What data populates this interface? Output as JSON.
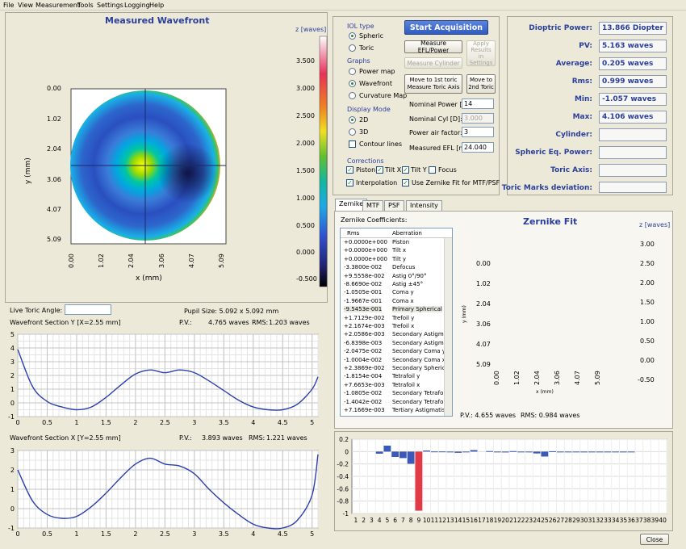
{
  "menu": [
    "File",
    "View",
    "Measurement",
    "Tools",
    "Settings",
    "Logging",
    "Help"
  ],
  "wavefront_map": {
    "title": "Measured Wavefront",
    "xlabel": "x (mm)",
    "ylabel": "y (mm)",
    "ticks": [
      "0.00",
      "1.02",
      "2.04",
      "3.06",
      "4.07",
      "5.09"
    ],
    "colorbar_title": "z [waves]",
    "colorbar_ticks": [
      "3.500",
      "3.000",
      "2.500",
      "2.000",
      "1.500",
      "1.000",
      "0.500",
      "0.000",
      "-0.500"
    ]
  },
  "controls": {
    "iol_type_label": "IOL type",
    "iol_spheric": "Spheric",
    "iol_toric": "Toric",
    "graphs_label": "Graphs",
    "graph_power": "Power map",
    "graph_wavefront": "Wavefront",
    "graph_curvature": "Curvature Map",
    "display_label": "Display Mode",
    "display_2d": "2D",
    "display_3d": "3D",
    "contour": "Contour lines",
    "start": "Start Acquisition",
    "measure_efl": "Measure EFL/Power",
    "apply_results": "Apply Results in Settings",
    "measure_cylinder": "Measure Cylinder",
    "move_first": "Move to 1st toric Measure Toric Axis",
    "move_second": "Move to 2nd Toric",
    "nominal_power_label": "Nominal Power [D]:",
    "nominal_power": "14",
    "nominal_cyl_label": "Nominal Cyl [D]:",
    "nominal_cyl": "3.000",
    "power_air_label": "Power air factor:",
    "power_air": "3",
    "measured_efl_label": "Measured EFL [mm]:",
    "measured_efl": "24.040",
    "corrections_label": "Corrections",
    "piston": "Piston",
    "tilt_x": "Tilt X",
    "tilt_y": "Tilt Y",
    "focus": "Focus",
    "interpolation": "Interpolation",
    "use_zernike": "Use Zernike Fit for MTF/PSF"
  },
  "results": [
    {
      "label": "Dioptric Power:",
      "value": "13.866 Diopter"
    },
    {
      "label": "PV:",
      "value": "5.163 waves"
    },
    {
      "label": "Average:",
      "value": "0.205 waves"
    },
    {
      "label": "Rms:",
      "value": "0.999 waves"
    },
    {
      "label": "Min:",
      "value": "-1.057 waves"
    },
    {
      "label": "Max:",
      "value": "4.106 waves"
    },
    {
      "label": "Cylinder:",
      "value": ""
    },
    {
      "label": "Spheric Eq. Power:",
      "value": ""
    },
    {
      "label": "Toric Axis:",
      "value": ""
    },
    {
      "label": "Toric Marks deviation:",
      "value": ""
    }
  ],
  "tabs": [
    "Zernike",
    "MTF",
    "PSF",
    "Intensity"
  ],
  "zernike": {
    "coeff_label": "Zernike Coefficients:",
    "col_rms": "Rms",
    "col_aberration": "Aberration",
    "rows": [
      [
        "+0.0000e+000",
        "Piston"
      ],
      [
        "+0.0000e+000",
        "Tilt x"
      ],
      [
        "+0.0000e+000",
        "Tilt y"
      ],
      [
        "-3.3800e-002",
        "Defocus"
      ],
      [
        "+9.5558e-002",
        "Astig 0°/90°"
      ],
      [
        "-8.6690e-002",
        "Astig ±45°"
      ],
      [
        "-1.0505e-001",
        "Coma y"
      ],
      [
        "-1.9667e-001",
        "Coma x"
      ],
      [
        "-9.5453e-001",
        "Primary Spherical"
      ],
      [
        "+1.7129e-002",
        "Trefoil y"
      ],
      [
        "+2.1674e-003",
        "Trefoil x"
      ],
      [
        "+2.0586e-003",
        "Secondary Astigmati"
      ],
      [
        "-6.8398e-003",
        "Secondary Astigmati"
      ],
      [
        "-2.0475e-002",
        "Secondary Coma y"
      ],
      [
        "-1.0004e-002",
        "Secondary Coma x"
      ],
      [
        "+2.3869e-002",
        "Secondary Spherica"
      ],
      [
        "-1.8154e-004",
        "Tetrafoil y"
      ],
      [
        "+7.6653e-003",
        "Tetrafoil x"
      ],
      [
        "-1.0805e-002",
        "Secondary Tetrafoil"
      ],
      [
        "-1.4042e-002",
        "Secondary Tetrafoil"
      ],
      [
        "+7.1669e-003",
        "Tertiary Astigmatism"
      ]
    ],
    "fit_title": "Zernike Fit",
    "fit_xlabel": "x (mm)",
    "fit_ylabel": "y (mm)",
    "fit_ticks": [
      "0.00",
      "1.02",
      "2.04",
      "3.06",
      "4.07",
      "5.09"
    ],
    "fit_colorbar_title": "z [waves]",
    "fit_colorbar_ticks": [
      "3.00",
      "2.50",
      "2.00",
      "1.50",
      "1.00",
      "0.50",
      "0.00",
      "-0.50"
    ],
    "fit_pv": "P.V.:  4.655 waves",
    "fit_rms": "RMS:  0.984 waves"
  },
  "live_toric_label": "Live Toric Angle:",
  "live_toric_value": "",
  "pupil_size": "Pupil Size: 5.092 x 5.092 mm",
  "section_y": {
    "title": "Wavefront Section Y [X=2.55 mm]",
    "pv_label": "P.V.:",
    "pv": "4.765 waves",
    "rms_label": "RMS:",
    "rms": "1.203 waves"
  },
  "section_x": {
    "title": "Wavefront Section X [Y=2.55 mm]",
    "pv_label": "P.V.:",
    "pv": "3.893 waves",
    "rms_label": "RMS:",
    "rms": "1.221 waves"
  },
  "close": "Close",
  "chart_data": [
    {
      "type": "line",
      "title": "Wavefront Section Y [X=2.55 mm]",
      "x": [
        0,
        0.25,
        0.5,
        0.75,
        1,
        1.25,
        1.5,
        1.75,
        2,
        2.25,
        2.5,
        2.75,
        3,
        3.25,
        3.5,
        3.75,
        4,
        4.25,
        4.5,
        4.75,
        5,
        5.1
      ],
      "y": [
        3.9,
        1.2,
        0.1,
        -0.3,
        -0.5,
        -0.3,
        0.4,
        1.3,
        2.1,
        2.4,
        2.2,
        2.4,
        2.2,
        1.6,
        0.9,
        0.2,
        -0.3,
        -0.5,
        -0.5,
        -0.1,
        1.0,
        1.9
      ],
      "xlim": [
        0,
        5.1
      ],
      "ylim": [
        -1,
        5
      ],
      "xticks": [
        0,
        0.5,
        1,
        1.5,
        2,
        2.5,
        3,
        3.5,
        4,
        4.5,
        5
      ],
      "yticks": [
        -1,
        0,
        1,
        2,
        3,
        4,
        5
      ],
      "grid": true
    },
    {
      "type": "line",
      "title": "Wavefront Section X [Y=2.55 mm]",
      "x": [
        0,
        0.25,
        0.5,
        0.75,
        1,
        1.25,
        1.5,
        1.75,
        2,
        2.25,
        2.5,
        2.75,
        3,
        3.25,
        3.5,
        3.75,
        4,
        4.25,
        4.5,
        4.75,
        5,
        5.1
      ],
      "y": [
        2.0,
        0.4,
        -0.3,
        -0.5,
        -0.4,
        0.1,
        0.8,
        1.6,
        2.3,
        2.6,
        2.3,
        2.2,
        1.8,
        1.0,
        0.3,
        -0.3,
        -0.8,
        -1.0,
        -1.0,
        -0.6,
        0.7,
        2.8
      ],
      "xlim": [
        0,
        5.1
      ],
      "ylim": [
        -1,
        3
      ],
      "xticks": [
        0,
        0.5,
        1,
        1.5,
        2,
        2.5,
        3,
        3.5,
        4,
        4.5,
        5
      ],
      "yticks": [
        -1,
        0,
        1,
        2,
        3
      ],
      "grid": true
    },
    {
      "type": "bar",
      "categories": [
        1,
        2,
        3,
        4,
        5,
        6,
        7,
        8,
        9,
        10,
        11,
        12,
        13,
        14,
        15,
        16,
        17,
        18,
        19,
        20,
        21,
        22,
        23,
        24,
        25,
        26,
        27,
        28,
        29,
        30,
        31,
        32,
        33,
        34,
        35,
        36,
        37,
        38,
        39,
        40
      ],
      "values": [
        0,
        0,
        0,
        -0.034,
        0.096,
        -0.087,
        -0.105,
        -0.197,
        -0.955,
        0.017,
        0.002,
        0.002,
        -0.007,
        -0.02,
        -0.01,
        0.024,
        0,
        0.008,
        -0.011,
        -0.014,
        0.007,
        -0.01,
        -0.012,
        -0.03,
        -0.08,
        0.005,
        -0.006,
        -0.004,
        -0.005,
        -0.003,
        -0.004,
        -0.002,
        -0.003,
        -0.002,
        -0.002,
        -0.001,
        0,
        0,
        0,
        0
      ],
      "highlight_index": 8,
      "ylim": [
        -1,
        0.2
      ],
      "yticks": [
        0.2,
        0,
        -0.2,
        -0.4,
        -0.6,
        -0.8,
        -1
      ],
      "bar_color": "#3b59b8",
      "highlight_color": "#e23a46",
      "grid": true
    }
  ]
}
